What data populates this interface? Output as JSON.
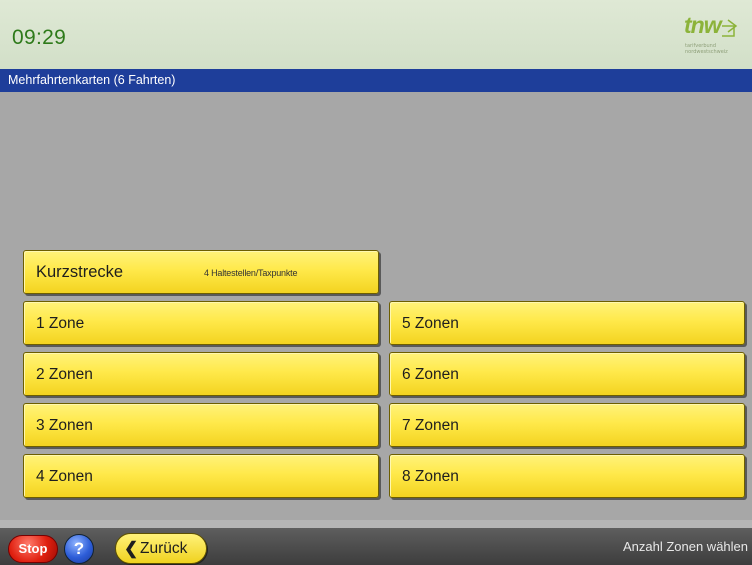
{
  "header": {
    "time": "09:29",
    "logo": {
      "brand": "tnw",
      "tagline_1": "tarifverbund",
      "tagline_2": "nordwestschweiz",
      "color": "#8cb33a"
    }
  },
  "title_bar": {
    "text": "Mehrfahrtenkarten (6 Fahrten)",
    "color": "#1e3e9a"
  },
  "options": {
    "kurzstrecke": {
      "label": "Kurzstrecke",
      "sublabel": "4 Haltestellen/Taxpunkte"
    },
    "zones_left": [
      "1 Zone",
      "2 Zonen",
      "3 Zonen",
      "4 Zonen"
    ],
    "zones_right": [
      "5 Zonen",
      "6 Zonen",
      "7 Zonen",
      "8 Zonen"
    ],
    "button_color": "#ffe94a"
  },
  "footer": {
    "stop_label": "Stop",
    "help_label": "?",
    "back_label": "Zurück",
    "back_icon": "chevron-left-icon",
    "hint": "Anzahl Zonen wählen"
  }
}
